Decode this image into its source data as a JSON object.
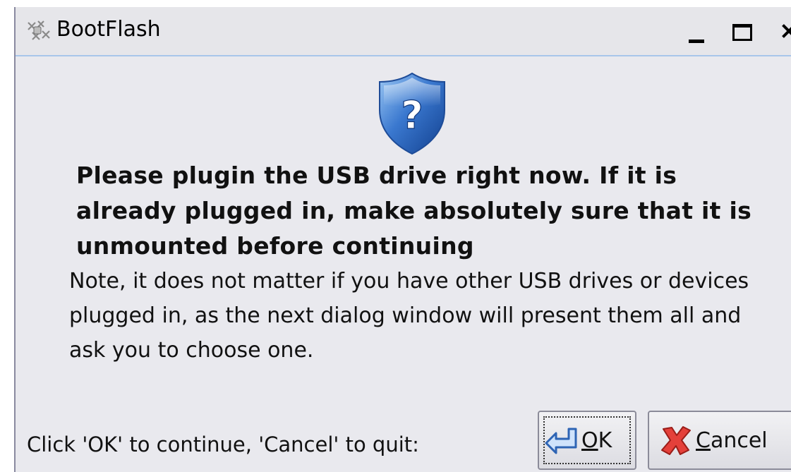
{
  "window": {
    "title": "BootFlash",
    "app_icon": "bootflash-app-icon",
    "controls": [
      "minimize-icon",
      "maximize-icon",
      "close-icon"
    ]
  },
  "dialog": {
    "icon": "shield-question-icon",
    "headline": "Please plugin the USB drive right now. If it is already plugged in, make absolutely sure that it is unmounted before continuing",
    "note": "Note, it does not matter if you have other USB drives or devices plugged in, as the next dialog window will present them all and ask you to choose one.",
    "footer_label": "Click 'OK' to continue, 'Cancel' to quit:"
  },
  "buttons": {
    "ok": {
      "mnemonic": "O",
      "rest": "K",
      "icon": "return-arrow-icon"
    },
    "cancel": {
      "mnemonic": "C",
      "rest": "ancel",
      "icon": "red-x-icon"
    }
  },
  "colors": {
    "window_bg": "#e9e9ee",
    "shield_blue": "#2b63b8",
    "cancel_red": "#d8302a"
  }
}
